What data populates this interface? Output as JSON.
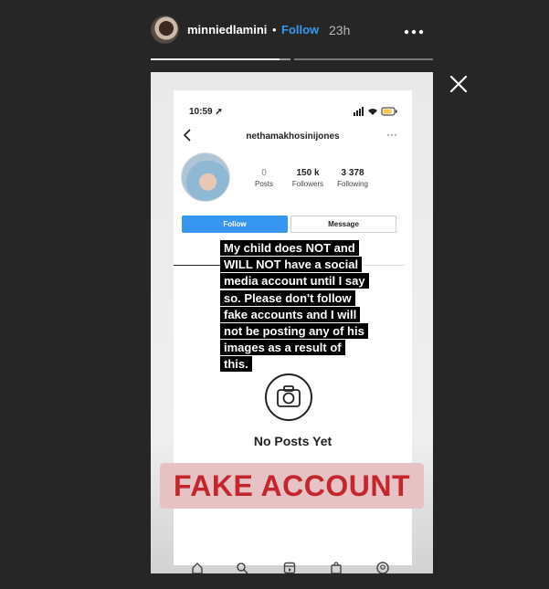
{
  "header": {
    "username": "minniedlamini",
    "separator": "•",
    "follow_label": "Follow",
    "time_ago": "23h",
    "more_label": "•••"
  },
  "progress": {
    "segments": 2,
    "current": 1,
    "current_fraction": 0.92
  },
  "story": {
    "status_time": "10:59 ➚",
    "profile": {
      "handle": "nethamakhosinijones",
      "more": "···",
      "posts_count": "0",
      "posts_label": "Posts",
      "followers_count": "150 k",
      "followers_label": "Followers",
      "following_count": "3 378",
      "following_label": "Following",
      "follow_button": "Follow",
      "message_button": "Message",
      "no_posts": "No Posts Yet"
    },
    "caption": "My child does NOT and WILL NOT have a social media account until I say so. Please don't follow fake accounts and I will not be posting any of his images as a result of this.",
    "label": "FAKE ACCOUNT"
  },
  "colors": {
    "accent": "#3897f0",
    "label_red": "#c4262e",
    "label_bg": "#e7c2c5",
    "background": "#262626"
  },
  "icons": [
    "avatar",
    "more-icon",
    "close-icon",
    "back-icon",
    "camera-icon",
    "home-icon",
    "search-icon",
    "reels-icon",
    "shop-icon",
    "profile-icon"
  ]
}
